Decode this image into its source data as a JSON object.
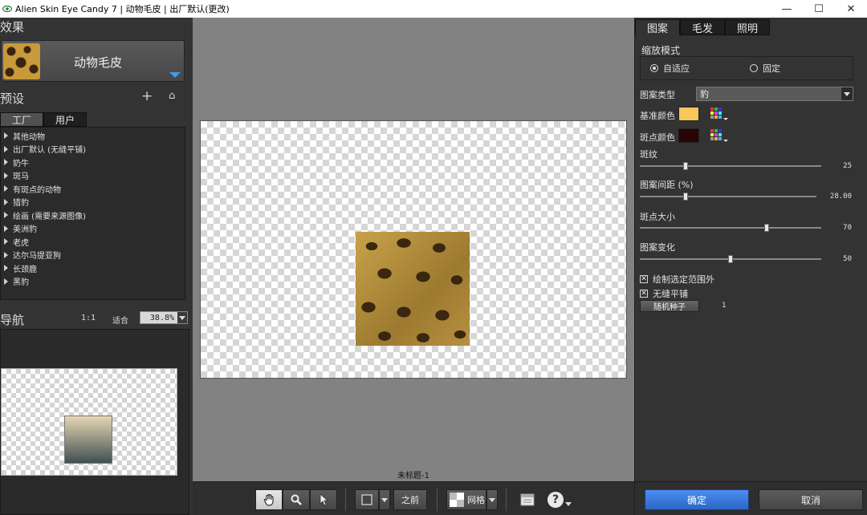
{
  "window": {
    "title": "Alien Skin Eye Candy 7 | 动物毛皮 | 出厂默认(更改)",
    "minimize": "—",
    "maximize": "☐",
    "close": "✕"
  },
  "left": {
    "effects_header": "效果",
    "effect_name": "动物毛皮",
    "presets_header": "预设",
    "add_icon": "+",
    "home_icon": "⌂",
    "tabs": [
      "工厂",
      "用户"
    ],
    "preset_items": [
      "其他动物",
      "出厂默认 (无缝平铺)",
      "奶牛",
      "斑马",
      "有斑点的动物",
      "猎豹",
      "绘画 (需要来源图像)",
      "美洲豹",
      "老虎",
      "达尔马提亚狗",
      "长颈鹿",
      "黑豹"
    ],
    "nav_header": "导航",
    "ratio": "1:1",
    "fit": "适合",
    "zoom": "38.8%"
  },
  "center": {
    "document_name": "未标题-1"
  },
  "toolbar": {
    "before_label": "之前",
    "grid_label": "网格",
    "help_icon": "?"
  },
  "right": {
    "tabs": [
      "图案",
      "毛发",
      "照明"
    ],
    "scale_mode_label": "缩放模式",
    "scale_options": [
      "自适应",
      "固定"
    ],
    "pattern_type_label": "图案类型",
    "pattern_type_value": "豹",
    "base_color_label": "基准颜色",
    "base_color": "#f7c75a",
    "spot_color_label": "斑点颜色",
    "spot_color": "#2a0404",
    "sliders": [
      {
        "label": "斑纹",
        "value": "25",
        "fraction": 0.25
      },
      {
        "label": "图案间距 (%)",
        "value": "28.00",
        "fraction": 0.26
      },
      {
        "label": "斑点大小",
        "value": "70",
        "fraction": 0.7
      },
      {
        "label": "图案变化",
        "value": "50",
        "fraction": 0.5
      }
    ],
    "checkboxes": [
      {
        "label": "绘制选定范围外",
        "checked": true
      },
      {
        "label": "无缝平铺",
        "checked": true
      }
    ],
    "seed_button": "随机种子",
    "seed_value": "1",
    "ok": "确定",
    "cancel": "取消"
  }
}
